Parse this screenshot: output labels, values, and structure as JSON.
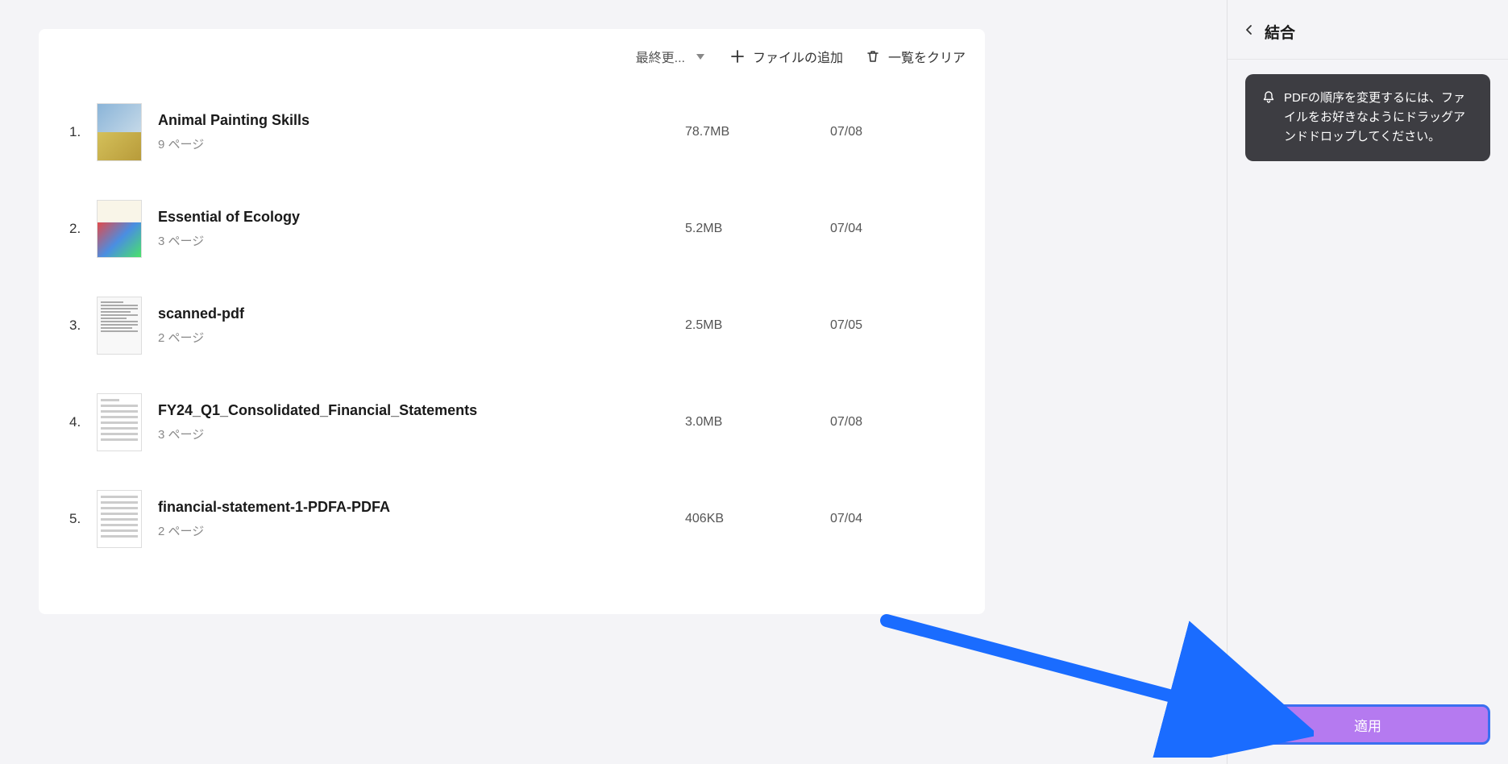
{
  "toolbar": {
    "sort_label": "最終更...",
    "add_file_label": "ファイルの追加",
    "clear_list_label": "一覧をクリア"
  },
  "files": [
    {
      "index": "1.",
      "name": "Animal Painting Skills",
      "pages": "9 ページ",
      "size": "78.7MB",
      "date": "07/08"
    },
    {
      "index": "2.",
      "name": "Essential of Ecology",
      "pages": "3 ページ",
      "size": "5.2MB",
      "date": "07/04"
    },
    {
      "index": "3.",
      "name": "scanned-pdf",
      "pages": "2 ページ",
      "size": "2.5MB",
      "date": "07/05"
    },
    {
      "index": "4.",
      "name": "FY24_Q1_Consolidated_Financial_Statements",
      "pages": "3 ページ",
      "size": "3.0MB",
      "date": "07/08"
    },
    {
      "index": "5.",
      "name": "financial-statement-1-PDFA-PDFA",
      "pages": "2 ページ",
      "size": "406KB",
      "date": "07/04"
    }
  ],
  "side": {
    "title": "結合",
    "tooltip_text": "PDFの順序を変更するには、ファイルをお好きなようにドラッグアンドドロップしてください。",
    "apply_label": "適用"
  }
}
